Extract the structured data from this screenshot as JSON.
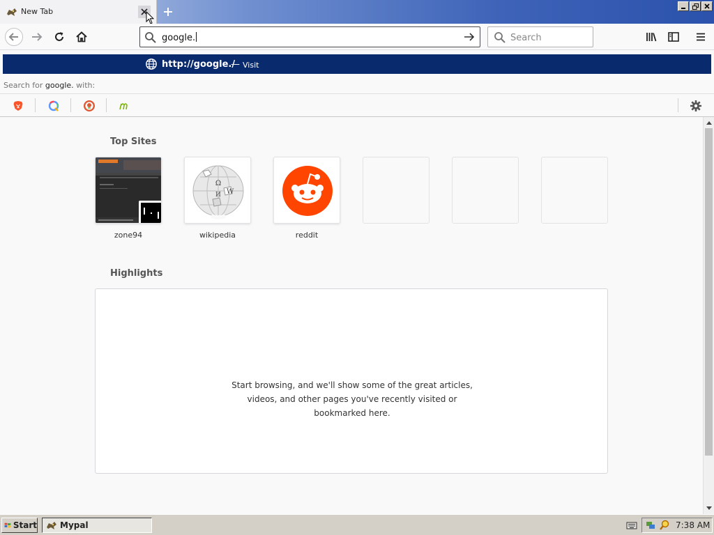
{
  "browser": {
    "tab_title": "New Tab",
    "url_value": "google.",
    "search_placeholder": "Search"
  },
  "autocomplete": {
    "result_url": "http://google./",
    "result_separator": "—",
    "result_action": "Visit",
    "search_for_prefix": "Search for",
    "search_for_query": "google.",
    "search_for_suffix": "with:",
    "engines": [
      "brave-icon",
      "qwant-icon",
      "duckduckgo-icon",
      "mojeek-icon"
    ]
  },
  "newtab": {
    "top_sites_title": "Top Sites",
    "top_sites": [
      {
        "label": "zone94"
      },
      {
        "label": "wikipedia"
      },
      {
        "label": "reddit"
      },
      {
        "label": ""
      },
      {
        "label": ""
      },
      {
        "label": ""
      }
    ],
    "highlights_title": "Highlights",
    "highlights_line1": "Start browsing, and we'll show some of the great articles,",
    "highlights_line2": "videos, and other pages you've recently visited or",
    "highlights_line3": "bookmarked here."
  },
  "taskbar": {
    "start_label": "Start",
    "task_label": "Mypal",
    "clock": "7:38 AM"
  },
  "colors": {
    "selected_row": "#0a2a6e",
    "reddit": "#ff4500",
    "title_gradient_end": "#2b52ac"
  }
}
